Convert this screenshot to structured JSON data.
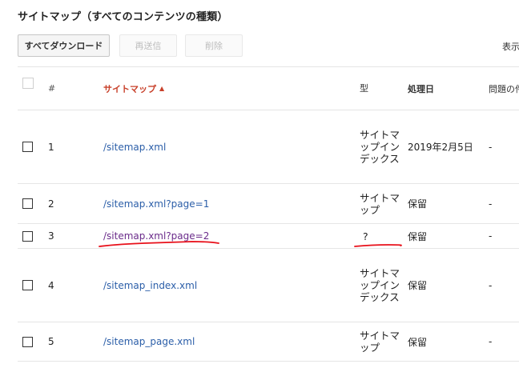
{
  "page": {
    "title": "サイトマップ（すべてのコンテンツの種類）"
  },
  "toolbar": {
    "download_label": "すべてダウンロード",
    "resend_label": "再送信",
    "delete_label": "削除",
    "display_label": "表示"
  },
  "table": {
    "columns": {
      "num": "#",
      "sitemap": "サイトマップ",
      "type": "型",
      "processed": "処理日",
      "issues": "問題の件"
    },
    "sort": {
      "column": "sitemap",
      "direction": "ascending"
    },
    "rows": [
      {
        "num": "1",
        "sitemap": "/sitemap.xml",
        "type": "サイトマップインデックス",
        "processed": "2019年2月5日",
        "issues": "-"
      },
      {
        "num": "2",
        "sitemap": "/sitemap.xml?page=1",
        "type": "サイトマップ",
        "processed": "保留",
        "issues": "-"
      },
      {
        "num": "3",
        "sitemap": "/sitemap.xml?page=2",
        "type": "?",
        "processed": "保留",
        "issues": "-"
      },
      {
        "num": "4",
        "sitemap": "/sitemap_index.xml",
        "type": "サイトマップインデックス",
        "processed": "保留",
        "issues": "-"
      },
      {
        "num": "5",
        "sitemap": "/sitemap_page.xml",
        "type": "サイトマップ",
        "processed": "保留",
        "issues": "-"
      }
    ]
  },
  "colors": {
    "link": "#2b5ea8",
    "visited_link": "#6a2b8a",
    "sort_header": "#c8402a",
    "annotation": "#e8101a"
  },
  "annotations": {
    "underlined_row": "3"
  }
}
